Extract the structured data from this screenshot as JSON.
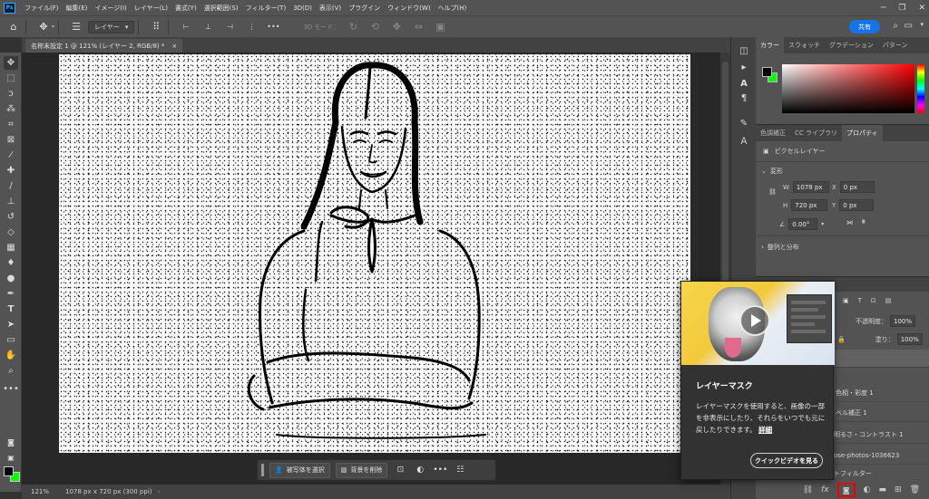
{
  "menubar": {
    "logo": "Ps",
    "items": [
      "ファイル(F)",
      "編集(E)",
      "イメージ(I)",
      "レイヤー(L)",
      "書式(Y)",
      "選択範囲(S)",
      "フィルター(T)",
      "3D(D)",
      "表示(V)",
      "プラグイン",
      "ウィンドウ(W)",
      "ヘルプ(H)"
    ]
  },
  "optionsbar": {
    "layer_select": "レイヤー",
    "mode_3d": "3D モード：",
    "share_label": "共有"
  },
  "document": {
    "tab_title": "名称未設定 1 @ 121% (レイヤー 2, RGB/8) *"
  },
  "taskbar": {
    "select_subject": "被写体を選択",
    "remove_background": "背景を削除",
    "more": "•••"
  },
  "statusbar": {
    "zoom": "121%",
    "doc_info": "1078 px x 720 px (300 ppi)"
  },
  "color_panel": {
    "tabs": [
      "カラー",
      "スウォッチ",
      "グラデーション",
      "パターン"
    ],
    "fg_color": "#000000",
    "bg_color": "#00ff00"
  },
  "properties_panel": {
    "tabs": [
      "色調補正",
      "CC ライブラリ",
      "プロパティ"
    ],
    "layer_type": "ピクセルレイヤー",
    "transform_title": "変形",
    "w_label": "W",
    "w_value": "1078 px",
    "h_label": "H",
    "h_value": "720 px",
    "x_label": "X",
    "x_value": "0 px",
    "y_label": "Y",
    "y_value": "0 px",
    "angle_value": "0.00°",
    "align_title": "整列と分布"
  },
  "layers_panel": {
    "opacity_label": "不透明度：",
    "opacity_value": "100%",
    "fill_label": "塗り：",
    "fill_value": "100%",
    "rows": [
      "色相・彩度 1",
      "ベル補正 1",
      "明るさ・コントラスト 1",
      "ose-photos-1036623",
      "トフィルター"
    ]
  },
  "tooltip": {
    "title": "レイヤーマスク",
    "body": "レイヤーマスクを使用すると、画像の一部を非表示にしたり、それらをいつでも元に戻したりできます。",
    "link": "詳細",
    "button": "クイックビデオを見る"
  }
}
